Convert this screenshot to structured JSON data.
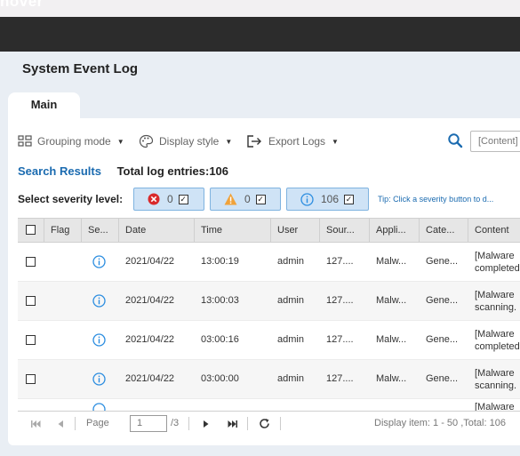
{
  "header": {
    "ghost_text": "nover"
  },
  "app": {
    "title": "System Event Log"
  },
  "tabs": [
    {
      "label": "Main"
    }
  ],
  "toolbar": {
    "grouping_label": "Grouping mode",
    "display_label": "Display style",
    "export_label": "Export Logs",
    "search_placeholder": "[Content]"
  },
  "results": {
    "title": "Search Results",
    "total_label": "Total log entries:106"
  },
  "severity": {
    "label": "Select severity level:",
    "error_count": "0",
    "warning_count": "0",
    "info_count": "106",
    "tip": "Tip: Click a severity button to d..."
  },
  "columns": [
    "Flag",
    "Se...",
    "Date",
    "Time",
    "User",
    "Sour...",
    "Appli...",
    "Cate...",
    "Content"
  ],
  "rows": [
    {
      "date": "2021/04/22",
      "time": "13:00:19",
      "user": "admin",
      "source": "127....",
      "app": "Malw...",
      "category": "Gene...",
      "content_1": "[Malware",
      "content_2": "completed"
    },
    {
      "date": "2021/04/22",
      "time": "13:00:03",
      "user": "admin",
      "source": "127....",
      "app": "Malw...",
      "category": "Gene...",
      "content_1": "[Malware",
      "content_2": "scanning."
    },
    {
      "date": "2021/04/22",
      "time": "03:00:16",
      "user": "admin",
      "source": "127....",
      "app": "Malw...",
      "category": "Gene...",
      "content_1": "[Malware",
      "content_2": "completed"
    },
    {
      "date": "2021/04/22",
      "time": "03:00:00",
      "user": "admin",
      "source": "127....",
      "app": "Malw...",
      "category": "Gene...",
      "content_1": "[Malware",
      "content_2": "scanning."
    },
    {
      "content_1": "[Malware"
    }
  ],
  "pager": {
    "page_label": "Page",
    "page_value": "1",
    "page_total": "/3",
    "display_info": "Display item: 1 - 50 ,Total: 106"
  },
  "colors": {
    "accent": "#1b6bb0",
    "info": "#2b8de0",
    "error": "#d9292b",
    "warning": "#f0a23a"
  }
}
